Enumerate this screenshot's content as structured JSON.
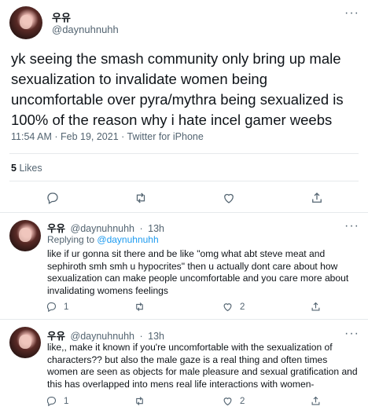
{
  "main_tweet": {
    "author_name": "우유",
    "author_handle": "@daynuhnuhh",
    "text": "yk seeing the smash community only bring up male sexualization to invalidate women being uncomfortable over pyra/mythra being sexualized is 100% of the reason why i hate incel gamer weebs",
    "timestamp": "11:54 AM · Feb 19, 2021 · Twitter for iPhone",
    "likes_count": "5",
    "likes_label": "Likes"
  },
  "replies": [
    {
      "author_name": "우유",
      "author_handle": "@daynuhnuhh",
      "time": "13h",
      "replying_to_label": "Replying to",
      "replying_to_handle": "@daynuhnuhh",
      "text": "like if ur gonna sit there and be like \"omg what abt steve meat and sephiroth smh smh u hypocrites\" then u actually dont care about how sexualization can make people uncomfortable and you care more about invalidating womens feelings",
      "reply_count": "1",
      "retweet_count": "",
      "like_count": "2"
    },
    {
      "author_name": "우유",
      "author_handle": "@daynuhnuhh",
      "time": "13h",
      "text": "like,, make it known if you're uncomfortable with the sexualization of characters?? but also the male gaze is a real thing and often times women are seen as objects for male pleasure and sexual gratification and this has overlapped into mens real life interactions with women-",
      "reply_count": "1",
      "retweet_count": "",
      "like_count": "2"
    }
  ],
  "icons": {
    "reply": "reply-icon",
    "retweet": "retweet-icon",
    "like": "like-icon",
    "share": "share-icon",
    "more": "more-icon"
  },
  "colors": {
    "text_primary": "#0f1419",
    "text_secondary": "#536471",
    "link": "#1d9bf0",
    "divider": "#e6e9ec"
  }
}
